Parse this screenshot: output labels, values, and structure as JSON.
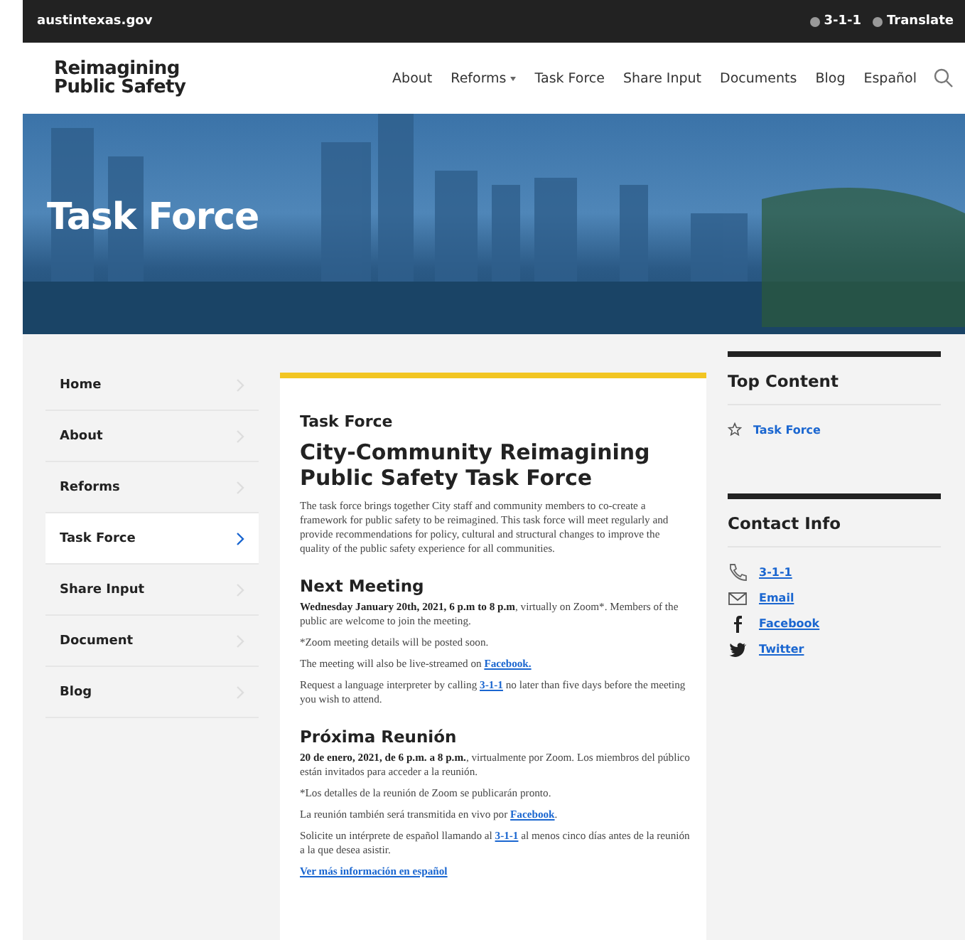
{
  "top_bar": {
    "site": "austintexas.gov",
    "links": [
      {
        "label": "3-1-1"
      },
      {
        "label": "Translate"
      }
    ]
  },
  "header": {
    "logo": "Reimagining Public Safety",
    "nav": [
      {
        "label": "About",
        "dropdown": false
      },
      {
        "label": "Reforms",
        "dropdown": true
      },
      {
        "label": "Task Force",
        "dropdown": false
      },
      {
        "label": "Share Input",
        "dropdown": false
      },
      {
        "label": "Documents",
        "dropdown": false
      },
      {
        "label": "Blog",
        "dropdown": false
      },
      {
        "label": "Español",
        "dropdown": false
      }
    ]
  },
  "hero": {
    "title": "Task Force"
  },
  "sidebar": {
    "items": [
      {
        "label": "Home",
        "selected": false
      },
      {
        "label": "About",
        "selected": false
      },
      {
        "label": "Reforms",
        "selected": false
      },
      {
        "label": "Task Force",
        "selected": true
      },
      {
        "label": "Share Input",
        "selected": false
      },
      {
        "label": "Document",
        "selected": false
      },
      {
        "label": "Blog",
        "selected": false
      }
    ]
  },
  "article": {
    "eyebrow": "Task Force",
    "title": "City-Community Reimagining Public Safety Task Force",
    "sections": [
      {
        "paragraphs": [
          [
            {
              "kind": "plain",
              "text": "The task force brings together City staff and community members to co-create a framework for public safety to be reimagined. This task force will meet regularly and provide recommendations for policy, cultural and structural changes to improve the quality of the public safety experience for all communities."
            }
          ]
        ]
      },
      {
        "heading": "Next Meeting",
        "paragraphs": [
          [
            {
              "kind": "bold",
              "text": "Wednesday January 20th, 2021, 6 p.m to 8 p.m"
            },
            {
              "kind": "plain",
              "text": ", virtually on Zoom*. Members of the public are welcome to join the meeting."
            }
          ],
          [
            {
              "kind": "plain",
              "text": "*Zoom meeting details will be posted soon."
            }
          ],
          [
            {
              "kind": "plain",
              "text": "The meeting will also be live-streamed on "
            },
            {
              "kind": "link",
              "text": "Facebook."
            }
          ],
          [
            {
              "kind": "plain",
              "text": "Request a language interpreter by calling "
            },
            {
              "kind": "link",
              "text": "3-1-1"
            },
            {
              "kind": "plain",
              "text": " no later than five days before the meeting you wish to attend."
            }
          ]
        ]
      },
      {
        "heading": "Próxima Reunión",
        "paragraphs": [
          [
            {
              "kind": "bold",
              "text": "20 de enero, 2021, de 6 p.m. a 8 p.m."
            },
            {
              "kind": "plain",
              "text": ", virtualmente por Zoom.  Los miembros del público están invitados para acceder a la reunión."
            }
          ],
          [
            {
              "kind": "plain",
              "text": "*Los detalles de la reunión de Zoom se publicarán pronto."
            }
          ],
          [
            {
              "kind": "plain",
              "text": "La reunión también será transmitida en vivo por "
            },
            {
              "kind": "link",
              "text": "Facebook"
            },
            {
              "kind": "plain",
              "text": "."
            }
          ],
          [
            {
              "kind": "plain",
              "text": "Solicite un intérprete de español llamando al "
            },
            {
              "kind": "link",
              "text": "3-1-1"
            },
            {
              "kind": "plain",
              "text": " al menos cinco días antes de la reunión a la que desea asistir."
            }
          ],
          [
            {
              "kind": "link",
              "text": "Ver más información en español"
            }
          ]
        ]
      }
    ]
  },
  "aside": {
    "top_content": {
      "title": "Top Content",
      "items": [
        {
          "label": "Task Force"
        }
      ]
    },
    "contact": {
      "title": "Contact Info",
      "items": [
        {
          "kind": "phone",
          "label": "3-1-1"
        },
        {
          "kind": "email",
          "label": "Email"
        },
        {
          "kind": "facebook",
          "label": "Facebook"
        },
        {
          "kind": "twitter",
          "label": "Twitter"
        }
      ]
    }
  }
}
